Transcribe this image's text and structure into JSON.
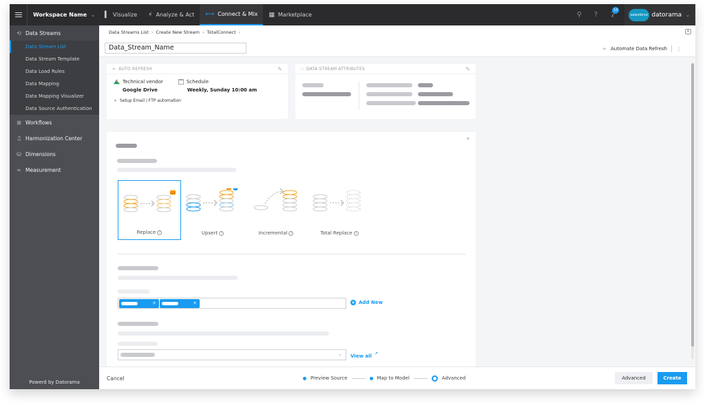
{
  "topbar": {
    "workspace": "Workspace Name",
    "nav": [
      {
        "label": "Visualize",
        "icon": "bar-chart-icon"
      },
      {
        "label": "Analyze & Act",
        "icon": "lightning-icon"
      },
      {
        "label": "Connect & Mix",
        "icon": "connect-icon",
        "active": true
      },
      {
        "label": "Marketplace",
        "icon": "grid-icon"
      }
    ],
    "notification_count": "10",
    "brand_cloud": "salesforce",
    "brand_name": "datorama"
  },
  "sidebar": {
    "sections": [
      {
        "label": "Data Streams",
        "icon": "data-streams-icon",
        "open": true,
        "items": [
          "Data Stream List",
          "Data Stream Template",
          "Data Load Rules",
          "Data Mapping",
          "Data Mapping Visualizer",
          "Data Source Authentication"
        ],
        "active_item": "Data Stream List"
      },
      {
        "label": "Workflows",
        "icon": "workflows-icon"
      },
      {
        "label": "Harmonization Center",
        "icon": "harmonization-icon"
      },
      {
        "label": "Dimensions",
        "icon": "dimensions-icon"
      },
      {
        "label": "Measurement",
        "icon": "measurement-icon"
      }
    ],
    "footer": "Powerd by Datorama"
  },
  "header": {
    "breadcrumb": [
      "Data Streams List",
      "Create New Stream",
      "TotalConnect"
    ],
    "stream_name": "Data_Stream_Name",
    "automate_label": "Automate Data Refresh"
  },
  "auto_refresh": {
    "title": "AUTO REFRESH",
    "vendor_label": "Technical vendor",
    "vendor_value": "Google Drive",
    "schedule_label": "Schedule",
    "schedule_value": "Weekly, Sunday 10:00 am",
    "ftp_label": "Setup Email / FTP automation"
  },
  "attributes": {
    "title": "DATA STREAM ATTRIBUTES"
  },
  "load_options": [
    {
      "label": "Replace",
      "selected": true
    },
    {
      "label": "Upsert",
      "selected": false
    },
    {
      "label": "Incremental",
      "selected": false
    },
    {
      "label": "Total Replace",
      "selected": false
    }
  ],
  "add_new_label": "Add New",
  "view_all_label": "View all",
  "footer": {
    "cancel": "Cancel",
    "steps": [
      {
        "label": "Preview Source",
        "current": false
      },
      {
        "label": "Map to Model",
        "current": false
      },
      {
        "label": "Advanced",
        "current": true
      }
    ],
    "advanced_button": "Advanced",
    "create_button": "Create"
  },
  "colors": {
    "accent": "#1a9bf0",
    "topbar": "#2b2b2d",
    "sidebar": "#4d4e53",
    "orange": "#f5a623"
  }
}
